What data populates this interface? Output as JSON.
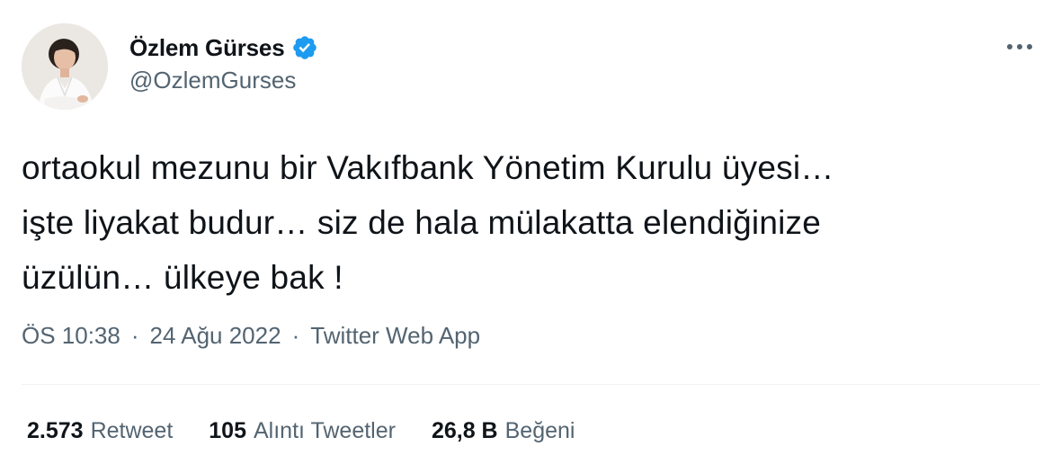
{
  "author": {
    "name": "Özlem Gürses",
    "handle": "@OzlemGurses",
    "verified_color": "#1d9bf0"
  },
  "tweet": {
    "lines": [
      "ortaokul mezunu bir Vakıfbank Yönetim Kurulu üyesi…",
      "işte liyakat budur… siz de hala mülakatta elendiğinize",
      "üzülün… ülkeye bak !"
    ]
  },
  "meta": {
    "time": "ÖS 10:38",
    "separator": "·",
    "date": "24 Ağu 2022",
    "source": "Twitter Web App"
  },
  "stats": [
    {
      "count": "2.573",
      "label": "Retweet"
    },
    {
      "count": "105",
      "label": "Alıntı Tweetler"
    },
    {
      "count": "26,8 B",
      "label": "Beğeni"
    }
  ],
  "icons": {
    "verified": "verified-badge-icon",
    "more": "more-horizontal-icon"
  },
  "colors": {
    "text": "#0f1419",
    "secondary": "#536471",
    "divider": "#eff3f4",
    "accent": "#1d9bf0"
  }
}
